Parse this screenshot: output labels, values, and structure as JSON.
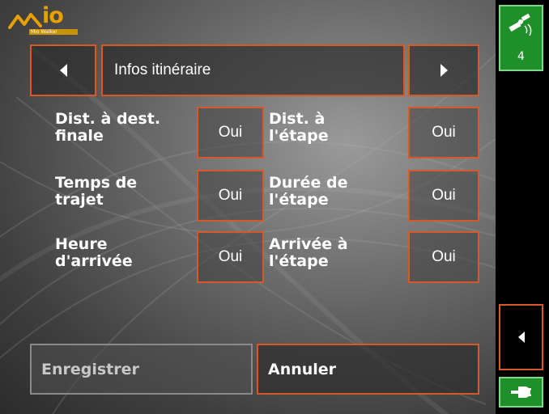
{
  "app": {
    "logo_text": "io",
    "logo_sub": "Mio Walker"
  },
  "header": {
    "prev_icon": "triangle-left-icon",
    "title": "Infos itinéraire",
    "next_icon": "triangle-right-icon"
  },
  "options": [
    {
      "label": "Dist. à dest.\nfinale",
      "value": "Oui"
    },
    {
      "label": "Dist. à\nl'étape",
      "value": "Oui"
    },
    {
      "label": "Temps de\ntrajet",
      "value": "Oui"
    },
    {
      "label": "Durée de\nl'étape",
      "value": "Oui"
    },
    {
      "label": "Heure\nd'arrivée",
      "value": "Oui"
    },
    {
      "label": "Arrivée à\nl'étape",
      "value": "Oui"
    }
  ],
  "footer": {
    "save_label": "Enregistrer",
    "cancel_label": "Annuler"
  },
  "sidebar": {
    "gps_icon": "satellite-icon",
    "gps_count": "4",
    "back_icon": "triangle-left-icon",
    "power_icon": "power-plug-icon"
  },
  "colors": {
    "accent_border": "#d55a2a",
    "status_green": "#1f8f2a",
    "logo_orange": "#e8a000"
  }
}
